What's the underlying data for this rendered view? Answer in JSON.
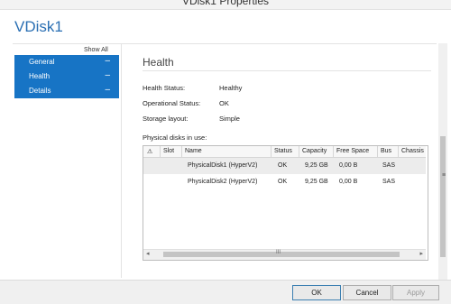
{
  "window": {
    "title": "VDisk1 Properties"
  },
  "page": {
    "heading": "VDisk1"
  },
  "nav": {
    "show_all": "Show All",
    "items": [
      {
        "label": "General",
        "toggle": "–"
      },
      {
        "label": "Health",
        "toggle": "–"
      },
      {
        "label": "Details",
        "toggle": "–"
      }
    ]
  },
  "section": {
    "title": "Health",
    "health_status_label": "Health Status:",
    "health_status_value": "Healthy",
    "operational_status_label": "Operational Status:",
    "operational_status_value": "OK",
    "storage_layout_label": "Storage layout:",
    "storage_layout_value": "Simple",
    "physical_disks_label": "Physical disks in use:"
  },
  "table": {
    "columns": [
      "⚠",
      "Slot",
      "Name",
      "Status",
      "Capacity",
      "Free Space",
      "Bus",
      "Chassis"
    ],
    "rows": [
      {
        "slot": "",
        "name": "PhysicalDisk1 (HyperV2)",
        "status": "OK",
        "capacity": "9,25 GB",
        "free_space": "0,00 B",
        "bus": "SAS",
        "chassis": ""
      },
      {
        "slot": "",
        "name": "PhysicalDisk2 (HyperV2)",
        "status": "OK",
        "capacity": "9,25 GB",
        "free_space": "0,00 B",
        "bus": "SAS",
        "chassis": ""
      }
    ]
  },
  "scroll": {
    "h_grip": "III",
    "v_grip": "≡"
  },
  "footer": {
    "ok": "OK",
    "cancel": "Cancel",
    "apply": "Apply"
  }
}
